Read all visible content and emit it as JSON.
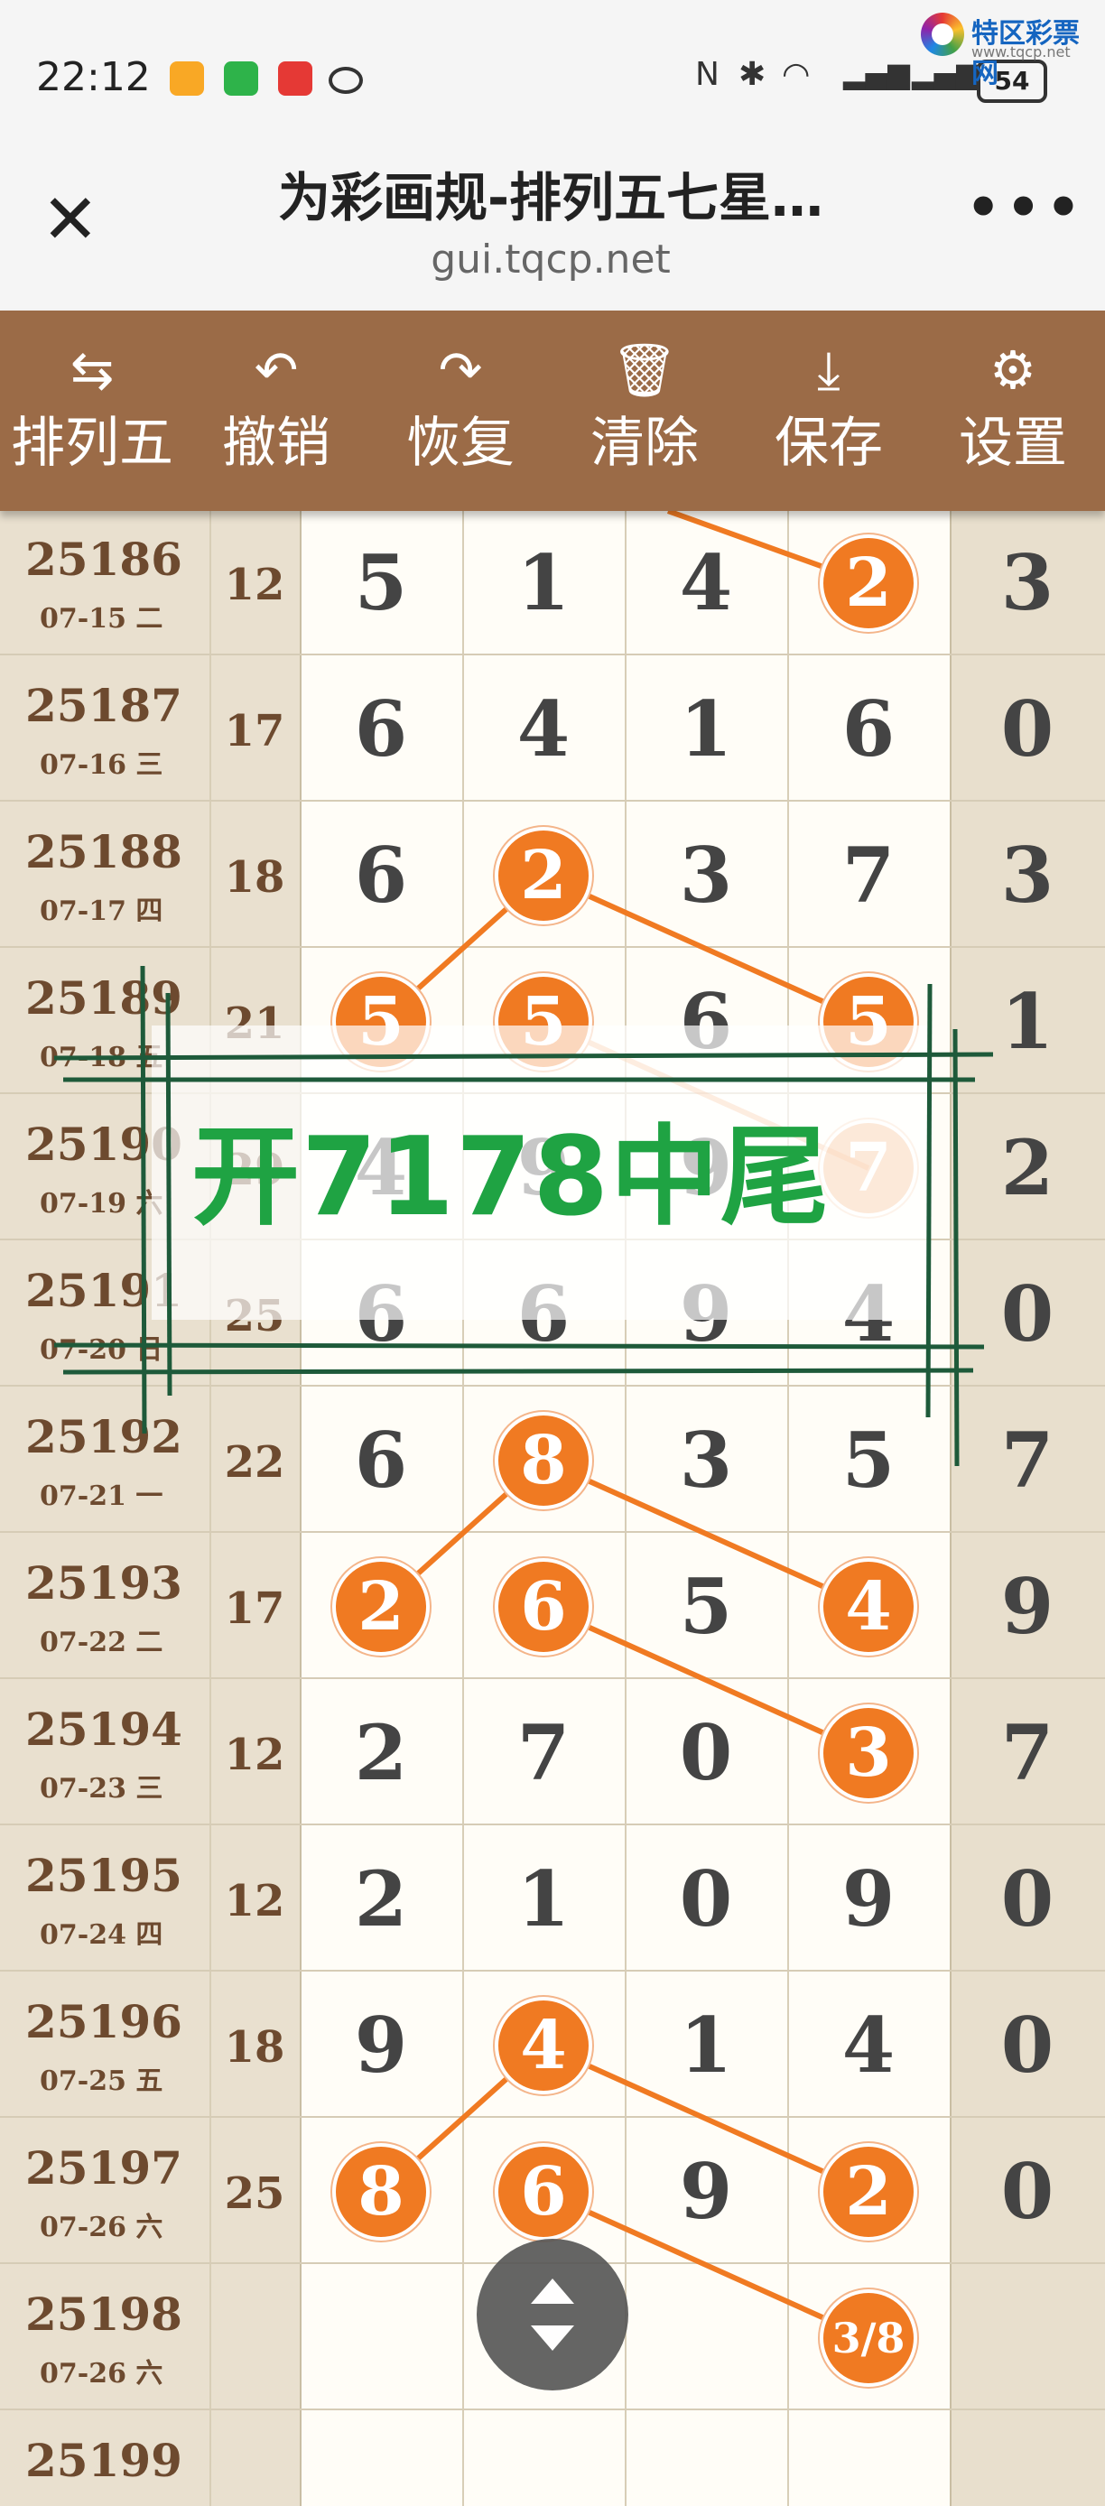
{
  "status_bar": {
    "time": "22:12",
    "battery": "54",
    "brand_name": "特区彩票网",
    "brand_url": "www.tqcp.net"
  },
  "title_bar": {
    "title": "为彩画规-排列五七星…",
    "url": "gui.tqcp.net",
    "close_icon": "close-icon",
    "more_icon": "more-icon"
  },
  "toolbar": {
    "items": [
      {
        "label": "排列五",
        "icon": "swap-icon",
        "glyph": "⇆"
      },
      {
        "label": "撤销",
        "icon": "undo-icon",
        "glyph": "↶"
      },
      {
        "label": "恢复",
        "icon": "redo-icon",
        "glyph": "↷"
      },
      {
        "label": "清除",
        "icon": "trash-icon",
        "glyph": "🗑"
      },
      {
        "label": "保存",
        "icon": "download-icon",
        "glyph": "⤓"
      },
      {
        "label": "设置",
        "icon": "gear-icon",
        "glyph": "⚙"
      }
    ]
  },
  "rows": [
    {
      "issue": "25186",
      "date": "07-15 二",
      "sum": "12",
      "d": [
        "5",
        "1",
        "4",
        "2"
      ],
      "last": "3"
    },
    {
      "issue": "25187",
      "date": "07-16 三",
      "sum": "17",
      "d": [
        "6",
        "4",
        "1",
        "6"
      ],
      "last": "0"
    },
    {
      "issue": "25188",
      "date": "07-17 四",
      "sum": "18",
      "d": [
        "6",
        "2",
        "3",
        "7"
      ],
      "last": "3"
    },
    {
      "issue": "25189",
      "date": "07-18 五",
      "sum": "21",
      "d": [
        "5",
        "5",
        "6",
        "5"
      ],
      "last": "1"
    },
    {
      "issue": "25190",
      "date": "07-19 六",
      "sum": "29",
      "d": [
        "4",
        "9",
        "9",
        "7"
      ],
      "last": "2"
    },
    {
      "issue": "25191",
      "date": "07-20 日",
      "sum": "25",
      "d": [
        "6",
        "6",
        "9",
        "4"
      ],
      "last": "0"
    },
    {
      "issue": "25192",
      "date": "07-21 一",
      "sum": "22",
      "d": [
        "6",
        "8",
        "3",
        "5"
      ],
      "last": "7"
    },
    {
      "issue": "25193",
      "date": "07-22 二",
      "sum": "17",
      "d": [
        "2",
        "6",
        "5",
        "4"
      ],
      "last": "9"
    },
    {
      "issue": "25194",
      "date": "07-23 三",
      "sum": "12",
      "d": [
        "2",
        "7",
        "0",
        "3"
      ],
      "last": "7"
    },
    {
      "issue": "25195",
      "date": "07-24 四",
      "sum": "12",
      "d": [
        "2",
        "1",
        "0",
        "9"
      ],
      "last": "0"
    },
    {
      "issue": "25196",
      "date": "07-25 五",
      "sum": "18",
      "d": [
        "9",
        "4",
        "1",
        "4"
      ],
      "last": "0"
    },
    {
      "issue": "25197",
      "date": "07-26 六",
      "sum": "25",
      "d": [
        "8",
        "6",
        "9",
        "2"
      ],
      "last": "0"
    },
    {
      "issue": "25198",
      "date": "07-26 六",
      "sum": "",
      "d": [
        "",
        "",
        "",
        "3/8"
      ],
      "last": ""
    },
    {
      "issue": "25199",
      "date": "",
      "sum": "",
      "d": [
        "",
        "",
        "",
        ""
      ],
      "last": ""
    }
  ],
  "highlights": [
    [
      0,
      3
    ],
    [
      2,
      1
    ],
    [
      3,
      0
    ],
    [
      3,
      1
    ],
    [
      3,
      3
    ],
    [
      4,
      3
    ],
    [
      6,
      1
    ],
    [
      7,
      0
    ],
    [
      7,
      1
    ],
    [
      7,
      3
    ],
    [
      8,
      3
    ],
    [
      10,
      1
    ],
    [
      11,
      0
    ],
    [
      11,
      1
    ],
    [
      11,
      3
    ],
    [
      12,
      3
    ]
  ],
  "annotation": {
    "text": "开7178中尾",
    "color": "#1fa343"
  },
  "colors": {
    "toolbar_bg": "#9b6b47",
    "ball": "#f07a22",
    "line": "#f07a22"
  },
  "scroll_button_icon": "scroll-updown-icon"
}
